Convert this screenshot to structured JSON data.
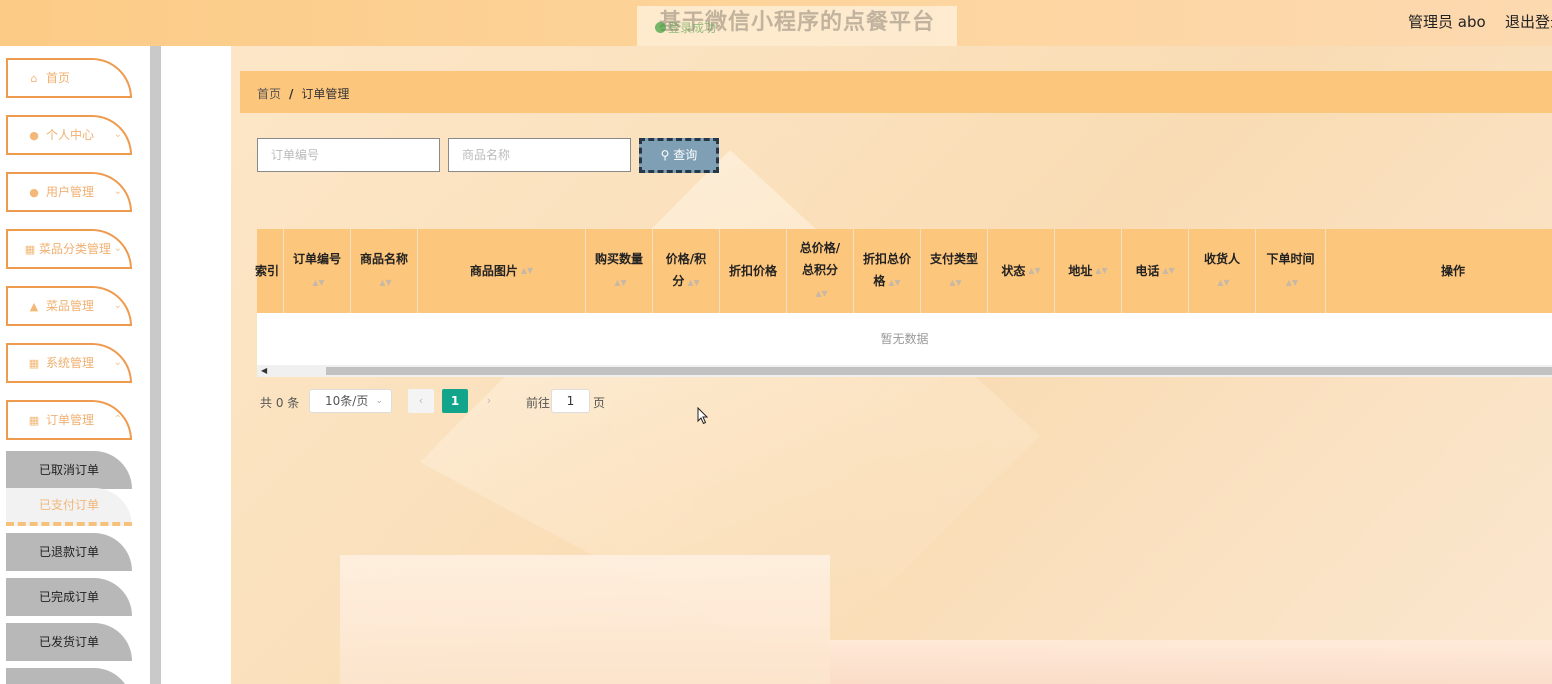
{
  "header": {
    "site_title": "基于微信小程序的点餐平台",
    "toast_text": "登录成功",
    "user": "管理员 abo",
    "logout": "退出登录"
  },
  "sidebar": {
    "items": [
      {
        "label": "首页",
        "icon": "home-icon"
      },
      {
        "label": "个人中心",
        "icon": "user-icon"
      },
      {
        "label": "用户管理",
        "icon": "pin-icon"
      },
      {
        "label": "菜品分类管理",
        "icon": "grid-icon"
      },
      {
        "label": "菜品管理",
        "icon": "thumb-icon"
      },
      {
        "label": "系统管理",
        "icon": "grid-icon"
      },
      {
        "label": "订单管理",
        "icon": "grid-icon"
      }
    ],
    "subitems": [
      {
        "label": "已取消订单",
        "active": false
      },
      {
        "label": "已支付订单",
        "active": true
      },
      {
        "label": "已退款订单",
        "active": false
      },
      {
        "label": "已完成订单",
        "active": false
      },
      {
        "label": "已发货订单",
        "active": false
      }
    ]
  },
  "breadcrumb": {
    "home": "首页",
    "separator": "/",
    "current": "订单管理"
  },
  "search": {
    "order_no_placeholder": "订单编号",
    "product_name_placeholder": "商品名称",
    "button_label": "查询"
  },
  "table": {
    "columns": [
      "索引",
      "订单编号",
      "商品名称",
      "商品图片",
      "购买数量",
      "价格/积分",
      "折扣价格",
      "总价格/总积分",
      "折扣总价格",
      "支付类型",
      "状态",
      "地址",
      "电话",
      "收货人",
      "下单时间",
      "操作"
    ],
    "empty_text": "暂无数据"
  },
  "pagination": {
    "total_text": "共 0 条",
    "page_size": "10条/页",
    "current_page": "1",
    "goto_label": "前往",
    "goto_value": "1",
    "page_unit": "页"
  },
  "colors": {
    "accent": "#fdc67d",
    "menu_border": "#ee9a4f",
    "page_active": "#12a58c",
    "search_button": "#7f9fb5"
  }
}
